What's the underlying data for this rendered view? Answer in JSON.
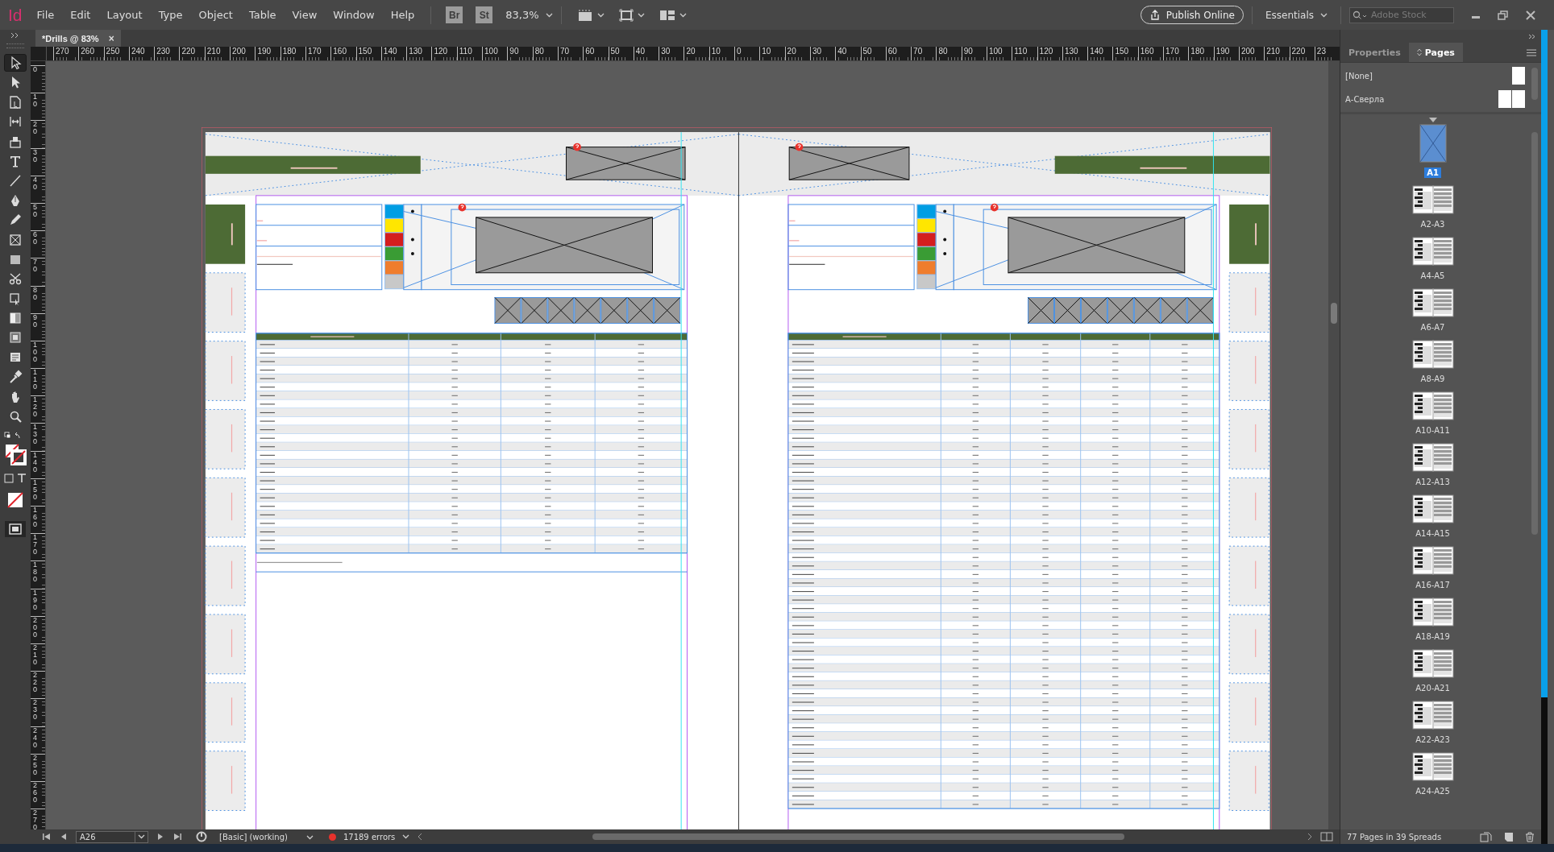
{
  "app": {
    "logo": "Id",
    "menu": [
      "File",
      "Edit",
      "Layout",
      "Type",
      "Object",
      "Table",
      "View",
      "Window",
      "Help"
    ],
    "bridge": "Br",
    "stock": "St",
    "zoom": "83,3%",
    "publish": "Publish Online",
    "workspace": "Essentials",
    "search": {
      "placeholder": "Adobe Stock"
    }
  },
  "document_tabs": [
    {
      "label": "*Drills @ 83%",
      "close": "×",
      "selected": true
    }
  ],
  "tools": [
    {
      "kind": "selection",
      "selected": true
    },
    {
      "kind": "direct",
      "selected": false
    },
    {
      "kind": "page",
      "selected": false
    },
    {
      "kind": "gap",
      "selected": false
    },
    {
      "kind": "collector",
      "selected": false
    },
    {
      "kind": "type",
      "selected": false
    },
    {
      "kind": "line",
      "selected": false
    },
    {
      "kind": "pen",
      "selected": false
    },
    {
      "kind": "pencil",
      "selected": false
    },
    {
      "kind": "frame",
      "selected": false
    },
    {
      "kind": "rectangle",
      "selected": false
    },
    {
      "kind": "scissors",
      "selected": false
    },
    {
      "kind": "transform",
      "selected": false
    },
    {
      "kind": "gradient",
      "selected": false
    },
    {
      "kind": "feather",
      "selected": false
    },
    {
      "kind": "note",
      "selected": false
    },
    {
      "kind": "eyedropper",
      "selected": false
    },
    {
      "kind": "hand",
      "selected": false
    },
    {
      "kind": "zoom",
      "selected": false
    }
  ],
  "rulers": {
    "horizontal": [
      "270",
      "260",
      "250",
      "240",
      "230",
      "220",
      "210",
      "200",
      "190",
      "180",
      "170",
      "160",
      "150",
      "140",
      "130",
      "120",
      "110",
      "100",
      "90",
      "80",
      "70",
      "60",
      "50",
      "40",
      "30",
      "20",
      "10",
      "0",
      "10",
      "20",
      "30",
      "40",
      "50",
      "60",
      "70",
      "80",
      "90",
      "100",
      "110",
      "120",
      "130",
      "140",
      "150",
      "160",
      "170",
      "180",
      "190",
      "200",
      "210",
      "220",
      "23"
    ],
    "vertical": [
      "0",
      "10",
      "20",
      "30",
      "40",
      "50",
      "60",
      "70",
      "80",
      "90",
      "100",
      "110",
      "120",
      "130",
      "140",
      "150",
      "160",
      "170",
      "180",
      "190",
      "200",
      "210",
      "220",
      "230",
      "240",
      "250",
      "260",
      "270"
    ]
  },
  "pages_panel": {
    "tabs": [
      {
        "label": "Properties",
        "selected": false
      },
      {
        "label": "Pages",
        "selected": true
      }
    ],
    "masters": [
      {
        "label": "[None]",
        "kind": "single"
      },
      {
        "label": "А-Сверла",
        "kind": "spread"
      }
    ],
    "spreads": [
      {
        "label": "A1",
        "kind": "single",
        "selected": true
      },
      {
        "label": "A2-A3",
        "kind": "spread",
        "selected": false
      },
      {
        "label": "A4-A5",
        "kind": "spread",
        "selected": false
      },
      {
        "label": "A6-A7",
        "kind": "spread",
        "selected": false
      },
      {
        "label": "A8-A9",
        "kind": "spread",
        "selected": false
      },
      {
        "label": "A10-A11",
        "kind": "spread",
        "selected": false
      },
      {
        "label": "A12-A13",
        "kind": "spread",
        "selected": false
      },
      {
        "label": "A14-A15",
        "kind": "spread",
        "selected": false
      },
      {
        "label": "A16-A17",
        "kind": "spread",
        "selected": false
      },
      {
        "label": "A18-A19",
        "kind": "spread",
        "selected": false
      },
      {
        "label": "A20-A21",
        "kind": "spread",
        "selected": false
      },
      {
        "label": "A22-A23",
        "kind": "spread",
        "selected": false
      },
      {
        "label": "A24-A25",
        "kind": "spread",
        "selected": false
      }
    ],
    "summary": "77 Pages in 39 Spreads"
  },
  "status_bar": {
    "page": "A26",
    "profile": "[Basic] (working)",
    "errors": "17189 errors"
  }
}
